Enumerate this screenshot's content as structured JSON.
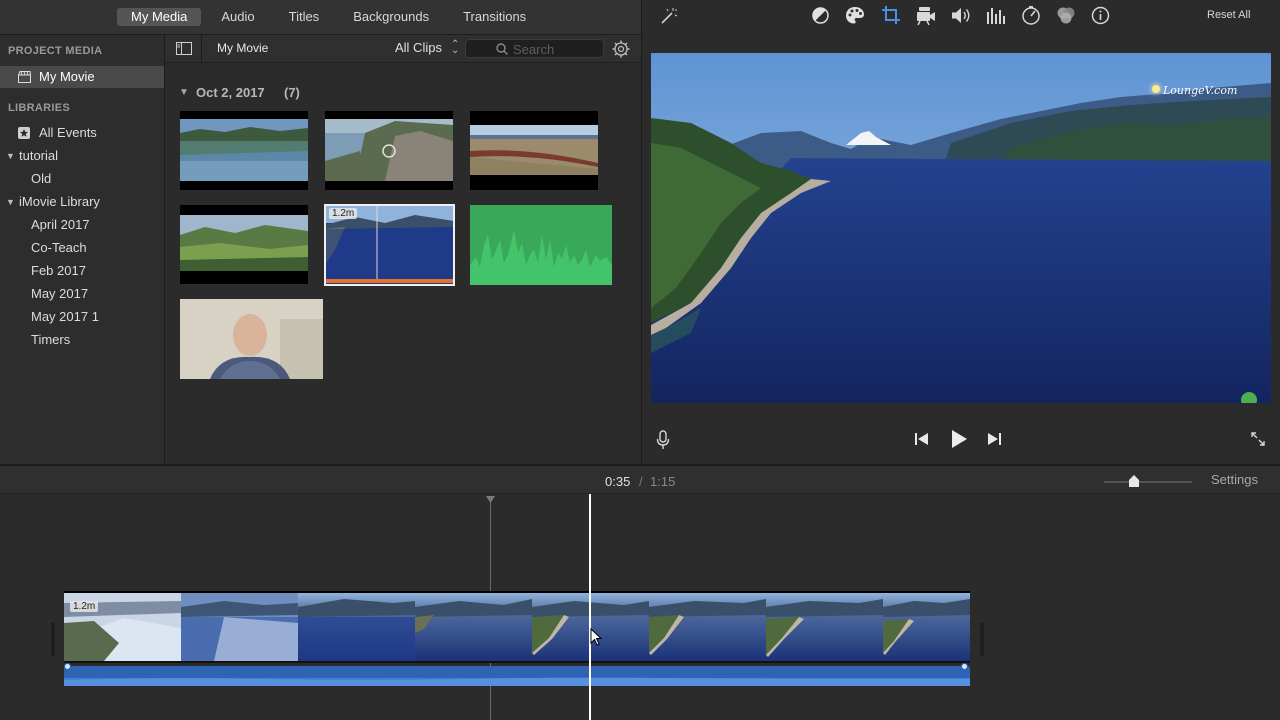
{
  "tabs": [
    {
      "label": "My Media"
    },
    {
      "label": "Audio"
    },
    {
      "label": "Titles"
    },
    {
      "label": "Backgrounds"
    },
    {
      "label": "Transitions"
    }
  ],
  "sidebar": {
    "project_media_heading": "PROJECT MEDIA",
    "project_item": "My Movie",
    "libraries_heading": "LIBRARIES",
    "items": [
      {
        "label": "All Events"
      },
      {
        "label": "tutorial"
      },
      {
        "label": "Old"
      },
      {
        "label": "iMovie Library"
      },
      {
        "label": "April 2017"
      },
      {
        "label": "Co-Teach"
      },
      {
        "label": "Feb 2017"
      },
      {
        "label": "May 2017"
      },
      {
        "label": "May 2017 1"
      },
      {
        "label": "Timers"
      }
    ]
  },
  "browser": {
    "title": "My Movie",
    "filter": "All Clips",
    "search_placeholder": "Search",
    "date_group": "Oct 2, 2017",
    "clip_count": "(7)",
    "selected_clip_badge": "1.2m"
  },
  "viewer": {
    "watermark": "LoungeV.com",
    "reset_label": "Reset All"
  },
  "timeline": {
    "current_time": "0:35",
    "separator": "/",
    "total_time": "1:15",
    "settings_label": "Settings",
    "clip_badge": "1.2m"
  },
  "icons": [
    "magic-wand-icon",
    "color-balance-icon",
    "color-palette-icon",
    "crop-icon",
    "stabilization-camera-icon",
    "volume-icon",
    "equalizer-icon",
    "speed-icon",
    "filter-icon",
    "info-icon",
    "microphone-icon",
    "skip-back-icon",
    "play-icon",
    "skip-forward-icon",
    "fullscreen-icon",
    "sidebar-toggle-icon",
    "gear-icon",
    "search-icon"
  ],
  "colors": {
    "accent_blue": "#3f7fd6",
    "audio_green": "#3aa85a",
    "selection_orange": "#e8702a"
  }
}
